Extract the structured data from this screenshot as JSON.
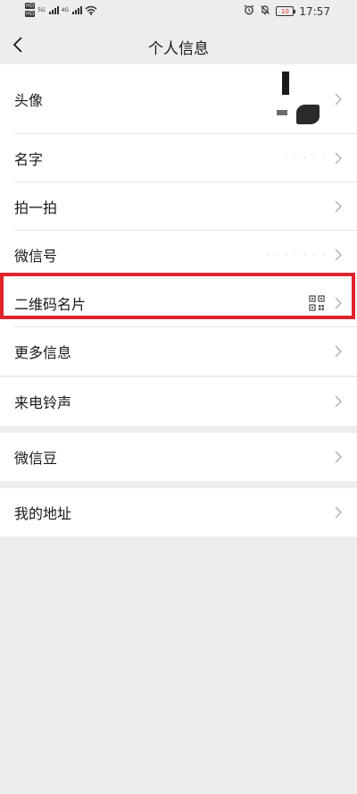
{
  "status_bar": {
    "hd1": "HD",
    "hd2": "HD",
    "net1": "5G",
    "net2": "4G",
    "battery": "10",
    "time": "17:57"
  },
  "nav": {
    "title": "个人信息"
  },
  "profile": {
    "avatar_label": "头像",
    "name_label": "名字",
    "pat_label": "拍一拍",
    "wechat_id_label": "微信号",
    "qr_label": "二维码名片",
    "more_label": "更多信息"
  },
  "ringtone": {
    "label": "来电铃声"
  },
  "beans": {
    "label": "微信豆"
  },
  "address": {
    "label": "我的地址"
  },
  "colors": {
    "background": "#ededed",
    "cell": "#ffffff",
    "highlight": "#e0242b",
    "text": "#191919",
    "chevron": "#b2b2b2"
  },
  "icons": [
    "back-arrow-icon",
    "chevron-right-icon",
    "qr-code-icon",
    "wifi-icon",
    "alarm-icon",
    "mute-icon",
    "battery-icon"
  ]
}
